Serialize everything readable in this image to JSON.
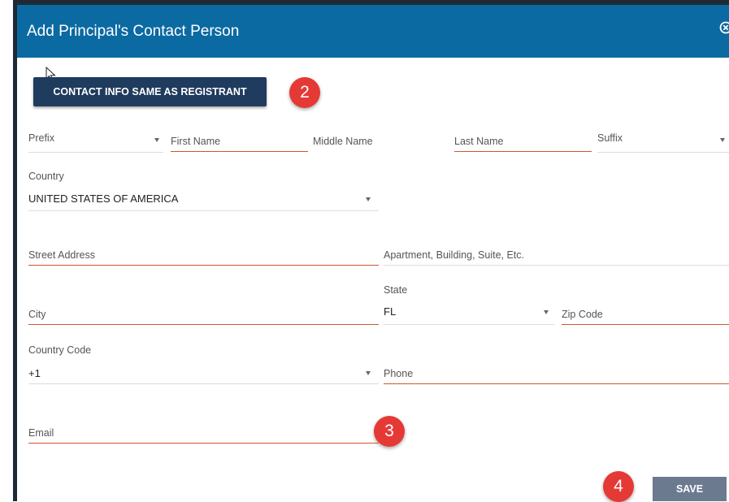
{
  "dialog": {
    "title": "Add Principal's Contact Person"
  },
  "actions": {
    "same_as_registrant": "CONTACT INFO SAME AS REGISTRANT",
    "save": "SAVE"
  },
  "callouts": [
    "2",
    "3",
    "4"
  ],
  "form": {
    "prefix": {
      "label": "Prefix",
      "value": ""
    },
    "first_name": {
      "label": "First Name",
      "value": ""
    },
    "middle_name": {
      "label": "Middle Name",
      "value": ""
    },
    "last_name": {
      "label": "Last Name",
      "value": ""
    },
    "suffix": {
      "label": "Suffix",
      "value": ""
    },
    "country": {
      "label": "Country",
      "value": "UNITED STATES OF AMERICA"
    },
    "street": {
      "label": "Street Address",
      "value": ""
    },
    "apartment": {
      "label": "Apartment, Building, Suite, Etc.",
      "value": ""
    },
    "city": {
      "label": "City",
      "value": ""
    },
    "state": {
      "label": "State",
      "value": "FL"
    },
    "zip": {
      "label": "Zip Code",
      "value": ""
    },
    "country_code": {
      "label": "Country Code",
      "value": "+1"
    },
    "phone": {
      "label": "Phone",
      "value": ""
    },
    "email": {
      "label": "Email",
      "value": ""
    }
  },
  "colors": {
    "header": "#0b6aa2",
    "primary_button": "#1f3b5e",
    "save_button": "#6c7a90",
    "required_underline": "#d2542c",
    "callout": "#e53935"
  },
  "icons": {
    "close": "close-circle-icon",
    "dropdown": "caret-down-icon",
    "cursor": "mouse-pointer-icon"
  }
}
